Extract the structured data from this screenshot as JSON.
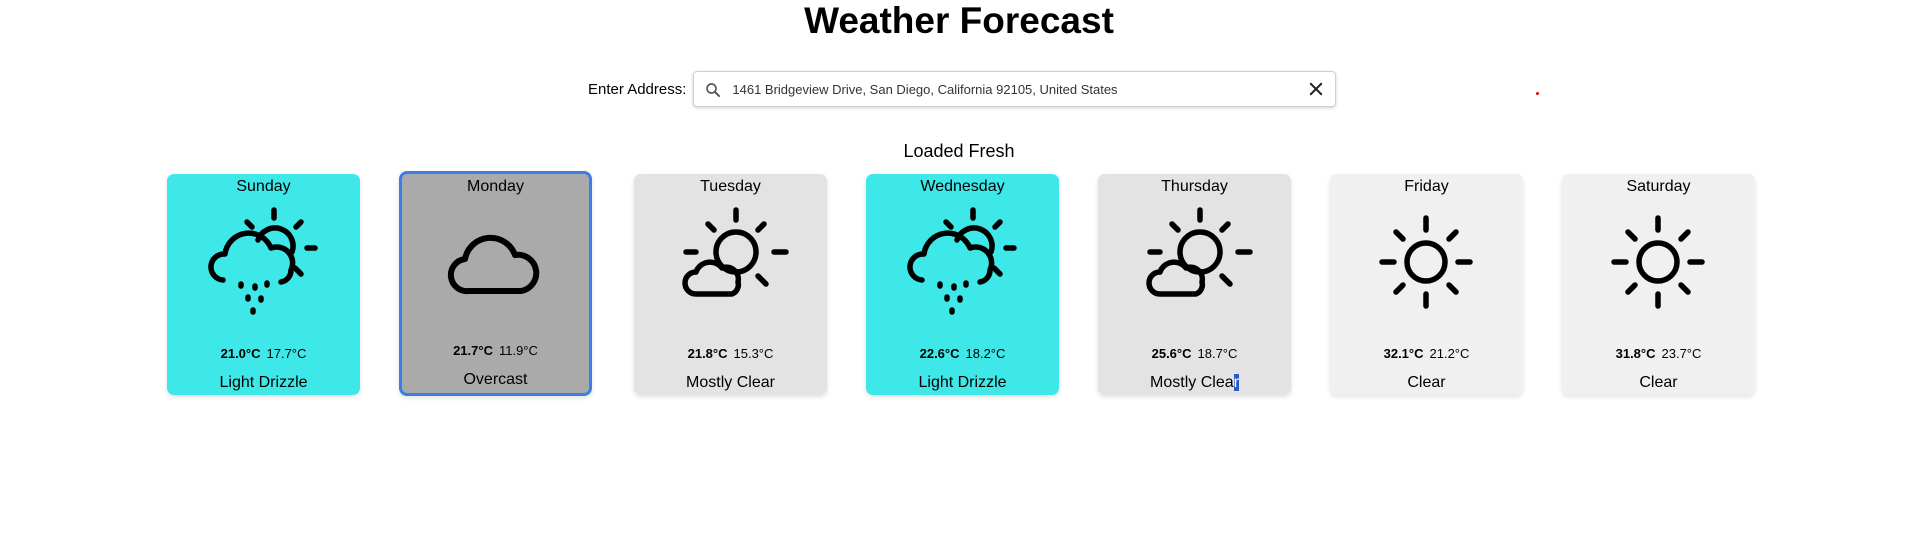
{
  "header": {
    "title": "Weather Forecast"
  },
  "address": {
    "label": "Enter Address:",
    "value": "1461 Bridgeview Drive, San Diego, California 92105, United States",
    "search_icon": "search-icon",
    "clear_icon": "close-icon"
  },
  "status": {
    "text": "Loaded Fresh"
  },
  "colors": {
    "rain_card": "#3fe8e8",
    "selected_card": "#aaaaaa",
    "neutral_card": "#e3e3e3",
    "clear_card": "#f0f0f0",
    "selected_border": "#3b7ee8"
  },
  "forecast": [
    {
      "day": "Sunday",
      "hi": "21.0°C",
      "lo": "17.7°C",
      "condition": "Light Drizzle",
      "icon": "drizzle-icon"
    },
    {
      "day": "Monday",
      "hi": "21.7°C",
      "lo": "11.9°C",
      "condition": "Overcast",
      "icon": "cloud-icon"
    },
    {
      "day": "Tuesday",
      "hi": "21.8°C",
      "lo": "15.3°C",
      "condition": "Mostly Clear",
      "icon": "partly-cloudy-icon"
    },
    {
      "day": "Wednesday",
      "hi": "22.6°C",
      "lo": "18.2°C",
      "condition": "Light Drizzle",
      "icon": "drizzle-icon"
    },
    {
      "day": "Thursday",
      "hi": "25.6°C",
      "lo": "18.7°C",
      "condition_part1": "Mostly Clea",
      "condition_part2": "r",
      "icon": "partly-cloudy-icon"
    },
    {
      "day": "Friday",
      "hi": "32.1°C",
      "lo": "21.2°C",
      "condition": "Clear",
      "icon": "sun-icon"
    },
    {
      "day": "Saturday",
      "hi": "31.8°C",
      "lo": "23.7°C",
      "condition": "Clear",
      "icon": "sun-icon"
    }
  ]
}
